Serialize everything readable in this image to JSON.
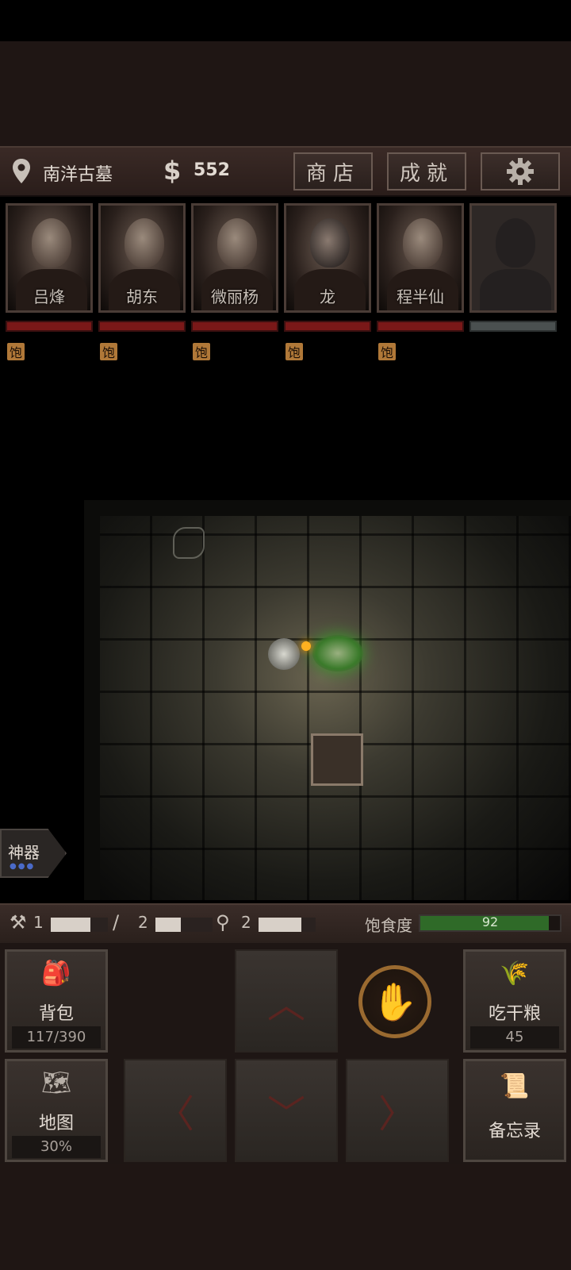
{
  "header": {
    "location": "南洋古墓",
    "money_symbol": "$",
    "money": "552",
    "shop_label": "商店",
    "achievements_label": "成就",
    "settings_icon": "gear-icon"
  },
  "party": [
    {
      "name": "吕烽",
      "status": "饱"
    },
    {
      "name": "胡东",
      "status": "饱"
    },
    {
      "name": "微丽杨",
      "status": "饱"
    },
    {
      "name": "龙",
      "status": "饱"
    },
    {
      "name": "程半仙",
      "status": "饱"
    }
  ],
  "artifact": {
    "label": "神器",
    "dots": "●●●"
  },
  "tools": [
    {
      "icon": "pickaxe-icon",
      "count": "1",
      "durability": 0.7
    },
    {
      "icon": "rope-hook-icon",
      "count": "2",
      "durability": 0.45
    },
    {
      "icon": "shovel-icon",
      "count": "2",
      "durability": 0.75
    }
  ],
  "hunger": {
    "label": "饱食度",
    "value": "92",
    "fraction": 0.92
  },
  "panels": {
    "backpack": {
      "label": "背包",
      "sub": "117/390"
    },
    "map": {
      "label": "地图",
      "sub": "30%"
    },
    "eat": {
      "label": "吃干粮",
      "sub": "45"
    },
    "memo": {
      "label": "备忘录"
    }
  },
  "dpad": {
    "up": "︿",
    "down": "﹀",
    "left": "〈",
    "right": "〉"
  },
  "colors": {
    "hp": "#7a1818",
    "hunger": "#2f6a28",
    "status_tag": "#b07838"
  }
}
